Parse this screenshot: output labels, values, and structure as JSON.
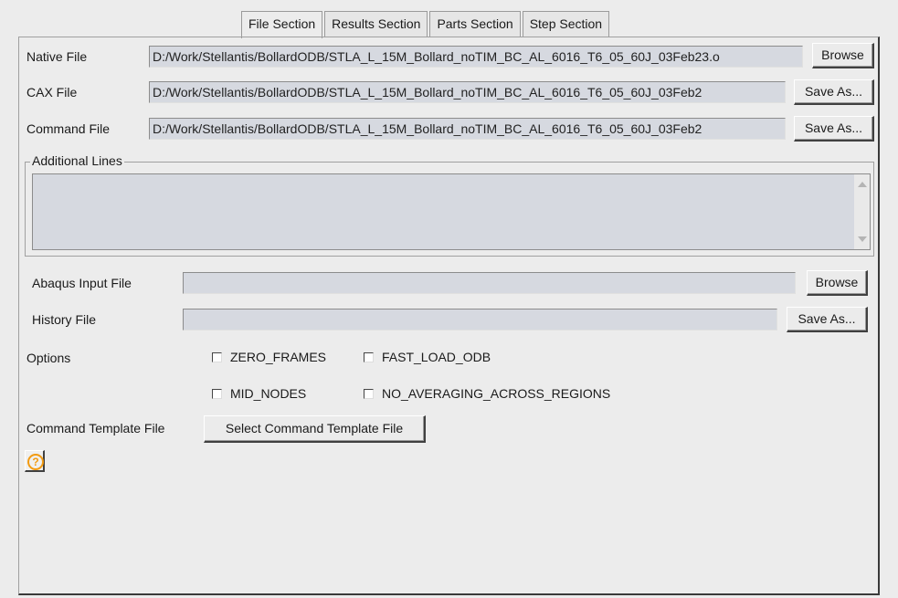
{
  "tabs": [
    {
      "label": "File Section",
      "active": true
    },
    {
      "label": "Results Section",
      "active": false
    },
    {
      "label": "Parts Section",
      "active": false
    },
    {
      "label": "Step Section",
      "active": false
    }
  ],
  "native_file": {
    "label": "Native File",
    "value": "D:/Work/Stellantis/BollardODB/STLA_L_15M_Bollard_noTIM_BC_AL_6016_T6_05_60J_03Feb23.o",
    "button": "Browse"
  },
  "cax_file": {
    "label": "CAX File",
    "value": "D:/Work/Stellantis/BollardODB/STLA_L_15M_Bollard_noTIM_BC_AL_6016_T6_05_60J_03Feb2",
    "button": "Save As..."
  },
  "command_file": {
    "label": "Command File",
    "value": "D:/Work/Stellantis/BollardODB/STLA_L_15M_Bollard_noTIM_BC_AL_6016_T6_05_60J_03Feb2",
    "button": "Save As..."
  },
  "additional_lines": {
    "label": "Additional Lines",
    "value": ""
  },
  "abaqus_input_file": {
    "label": "Abaqus Input File",
    "value": "",
    "button": "Browse"
  },
  "history_file": {
    "label": "History File",
    "value": "",
    "button": "Save As..."
  },
  "options": {
    "label": "Options",
    "items": [
      {
        "label": "ZERO_FRAMES",
        "checked": false
      },
      {
        "label": "FAST_LOAD_ODB",
        "checked": false
      },
      {
        "label": "MID_NODES",
        "checked": false
      },
      {
        "label": "NO_AVERAGING_ACROSS_REGIONS",
        "checked": false
      }
    ]
  },
  "command_template": {
    "label": "Command Template File",
    "button": "Select Command Template File"
  },
  "help": {
    "icon": "help-icon",
    "glyph": "?",
    "color": "#f29b12"
  }
}
